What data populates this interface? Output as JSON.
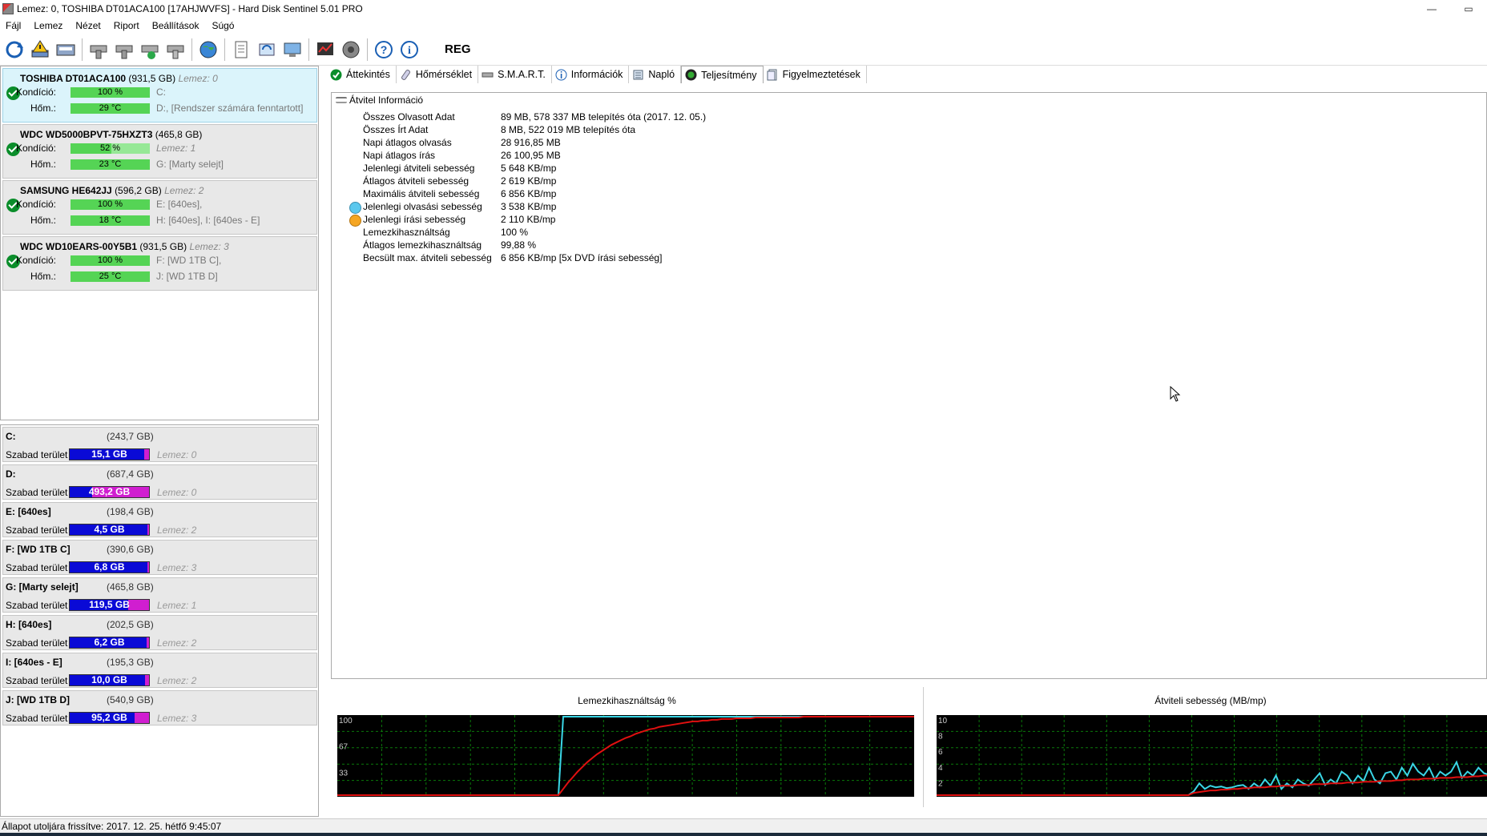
{
  "window": {
    "title": "Lemez: 0, TOSHIBA DT01ACA100 [17AHJWVFS]  -  Hard Disk Sentinel 5.01 PRO",
    "minimize": "—",
    "restore": "▭"
  },
  "menu": [
    "Fájl",
    "Lemez",
    "Nézet",
    "Riport",
    "Beállítások",
    "Súgó"
  ],
  "toolbar": {
    "icons": [
      "refresh-icon",
      "warning-disk-icon",
      "disk-icon",
      "tool-1-icon",
      "tool-2-icon",
      "tool-3-icon",
      "tool-4-icon",
      "globe-icon",
      "document-icon",
      "sync-icon",
      "network-icon",
      "report-icon",
      "speaker-icon",
      "help-icon",
      "info-icon"
    ],
    "reg_label": "REG"
  },
  "disks": [
    {
      "name": "TOSHIBA DT01ACA100",
      "size": "(931,5 GB)",
      "lemez": "Lemez: 0",
      "kondicio_label": "Kondíció:",
      "kondicio": "100 %",
      "kondicio_pct": 100,
      "hom_label": "Hőm.:",
      "hom": "29 °C",
      "drive1": "C:",
      "drive2": "D:, [Rendszer számára fenntartott]",
      "drive1_italic": false,
      "selected": true
    },
    {
      "name": "WDC WD5000BPVT-75HXZT3",
      "size": "(465,8 GB)",
      "lemez": "",
      "kondicio_label": "Kondíció:",
      "kondicio": "52 %",
      "kondicio_pct": 52,
      "hom_label": "Hőm.:",
      "hom": "23 °C",
      "drive1": "Lemez: 1",
      "drive2": "G: [Marty selejt]",
      "drive1_italic": true,
      "selected": false
    },
    {
      "name": "SAMSUNG HE642JJ",
      "size": "(596,2 GB)",
      "lemez": "Lemez: 2",
      "kondicio_label": "Kondíció:",
      "kondicio": "100 %",
      "kondicio_pct": 100,
      "hom_label": "Hőm.:",
      "hom": "18 °C",
      "drive1": "E: [640es],",
      "drive2": "H: [640es], I: [640es - E]",
      "drive1_italic": false,
      "selected": false
    },
    {
      "name": "WDC WD10EARS-00Y5B1",
      "size": "(931,5 GB)",
      "lemez": "Lemez: 3",
      "kondicio_label": "Kondíció:",
      "kondicio": "100 %",
      "kondicio_pct": 100,
      "hom_label": "Hőm.:",
      "hom": "25 °C",
      "drive1": "F: [WD 1TB C],",
      "drive2": "J: [WD 1TB D]",
      "drive1_italic": false,
      "selected": false
    }
  ],
  "partitions": [
    {
      "name": "C:",
      "size": "(243,7 GB)",
      "label": "Szabad terület",
      "free": "15,1 GB",
      "used_pct": 94,
      "lemez": "Lemez: 0"
    },
    {
      "name": "D:",
      "size": "(687,4 GB)",
      "label": "Szabad terület",
      "free": "493,2 GB",
      "used_pct": 28,
      "lemez": "Lemez: 0"
    },
    {
      "name": "E: [640es]",
      "size": "(198,4 GB)",
      "label": "Szabad terület",
      "free": "4,5 GB",
      "used_pct": 98,
      "lemez": "Lemez: 2"
    },
    {
      "name": "F: [WD 1TB C]",
      "size": "(390,6 GB)",
      "label": "Szabad terület",
      "free": "6,8 GB",
      "used_pct": 98,
      "lemez": "Lemez: 3"
    },
    {
      "name": "G: [Marty selejt]",
      "size": "(465,8 GB)",
      "label": "Szabad terület",
      "free": "119,5 GB",
      "used_pct": 74,
      "lemez": "Lemez: 1"
    },
    {
      "name": "H: [640es]",
      "size": "(202,5 GB)",
      "label": "Szabad terület",
      "free": "6,2 GB",
      "used_pct": 97,
      "lemez": "Lemez: 2"
    },
    {
      "name": "I: [640es - E]",
      "size": "(195,3 GB)",
      "label": "Szabad terület",
      "free": "10,0 GB",
      "used_pct": 95,
      "lemez": "Lemez: 2"
    },
    {
      "name": "J: [WD 1TB D]",
      "size": "(540,9 GB)",
      "label": "Szabad terület",
      "free": "95,2 GB",
      "used_pct": 82,
      "lemez": "Lemez: 3"
    }
  ],
  "tabs": [
    "Áttekintés",
    "Hőmérséklet",
    "S.M.A.R.T.",
    "Információk",
    "Napló",
    "Teljesítmény",
    "Figyelmeztetések"
  ],
  "active_tab": "Teljesítmény",
  "section": {
    "title": "Átvitel Információ"
  },
  "info": [
    {
      "key": "Összes Olvasott Adat",
      "value": "89 MB,  578 337 MB telepítés óta  (2017. 12. 05.)"
    },
    {
      "key": "Összes Írt Adat",
      "value": "8 MB,  522 019 MB telepítés óta"
    },
    {
      "key": "Napi átlagos olvasás",
      "value": "28 916,85 MB"
    },
    {
      "key": "Napi átlagos írás",
      "value": "26 100,95 MB"
    },
    {
      "key": "Jelenlegi átviteli sebesség",
      "value": "5 648 KB/mp"
    },
    {
      "key": "Átlagos átviteli sebesség",
      "value": "2 619 KB/mp"
    },
    {
      "key": "Maximális átviteli sebesség",
      "value": "6 856 KB/mp"
    },
    {
      "key": "Jelenlegi olvasási sebesség",
      "value": "3 538 KB/mp"
    },
    {
      "key": "Jelenlegi írási sebesség",
      "value": "2 110 KB/mp"
    },
    {
      "key": "Lemezkihasználtság",
      "value": "100 %"
    },
    {
      "key": "Átlagos lemezkihasználtság",
      "value": "99,88 %"
    },
    {
      "key": "Becsült max. átviteli sebesség",
      "value": "6 856 KB/mp [5x DVD írási sebesség]"
    }
  ],
  "colors": {
    "read": "#5bc8ee",
    "write": "#f5a623",
    "ok": "#0a8d2a",
    "free_bar": "#0a0ad6",
    "used_bar": "#d01ed0"
  },
  "chart_data": [
    {
      "type": "line",
      "title": "Lemezkihasználtság %",
      "ylim": [
        0,
        100
      ],
      "yticks": [
        "100",
        "67",
        "33"
      ],
      "series": [
        {
          "values": [
            0,
            0,
            0,
            0,
            0,
            0,
            0,
            0,
            0,
            0,
            0,
            0,
            0,
            0,
            0,
            0,
            0,
            0,
            0,
            0,
            0,
            0,
            0,
            0,
            0,
            0,
            0,
            0,
            0,
            0,
            0,
            0,
            0,
            0,
            0,
            0,
            0,
            0,
            0,
            0,
            0,
            0,
            0,
            0,
            0,
            0,
            0,
            100,
            100,
            100,
            100,
            100,
            100,
            100,
            100,
            100,
            100,
            100,
            100,
            100,
            100,
            100,
            100,
            100,
            100,
            100,
            100,
            100,
            100,
            100,
            100,
            100,
            100,
            100,
            100,
            100,
            100,
            100,
            100,
            100,
            100,
            100,
            100,
            100,
            100,
            100,
            100,
            100,
            100,
            100,
            100,
            100,
            100,
            100,
            100,
            100,
            100,
            100,
            100,
            100,
            100,
            100,
            100,
            100,
            100,
            100,
            100,
            100,
            100,
            100,
            100,
            100,
            100,
            100,
            100,
            100,
            100,
            100,
            100,
            100,
            100
          ]
        },
        {
          "values": [
            0,
            0,
            0,
            0,
            0,
            0,
            0,
            0,
            0,
            0,
            0,
            0,
            0,
            0,
            0,
            0,
            0,
            0,
            0,
            0,
            0,
            0,
            0,
            0,
            0,
            0,
            0,
            0,
            0,
            0,
            0,
            0,
            0,
            0,
            0,
            0,
            0,
            0,
            0,
            0,
            0,
            0,
            0,
            0,
            0,
            0,
            0,
            8,
            16,
            23,
            30,
            36,
            42,
            47,
            52,
            56,
            60,
            64,
            67,
            70,
            73,
            75,
            78,
            80,
            82,
            84,
            85,
            87,
            88,
            89,
            90,
            91,
            92,
            93,
            94,
            94,
            95,
            95,
            96,
            96,
            97,
            97,
            97,
            98,
            98,
            98,
            98,
            99,
            99,
            99,
            99,
            99,
            99,
            99,
            99,
            99,
            99,
            100,
            100,
            100,
            100,
            100,
            100,
            100,
            100,
            100,
            100,
            100,
            100,
            100,
            100,
            100,
            100,
            100,
            100,
            100,
            100,
            100,
            100,
            100,
            100
          ]
        }
      ]
    },
    {
      "type": "line",
      "title": "Átviteli sebesség (MB/mp)",
      "ylim": [
        0,
        10
      ],
      "yticks": [
        "10",
        "8",
        "6",
        "4",
        "2"
      ],
      "series": [
        {
          "values": [
            0,
            0,
            0,
            0,
            0,
            0,
            0,
            0,
            0,
            0,
            0,
            0,
            0,
            0,
            0,
            0,
            0,
            0,
            0,
            0,
            0,
            0,
            0,
            0,
            0,
            0,
            0,
            0,
            0,
            0,
            0,
            0,
            0,
            0,
            0,
            0,
            0,
            0,
            0,
            0,
            0,
            0,
            0,
            0,
            0,
            0,
            0,
            0.5,
            1.5,
            0.8,
            1.2,
            1.0,
            1.1,
            0.9,
            1.0,
            1.2,
            1.3,
            0.8,
            1.5,
            1.0,
            2.0,
            1.2,
            2.5,
            0.8,
            1.5,
            1.0,
            2.0,
            1.5,
            1.2,
            2.0,
            2.8,
            1.3,
            2.0,
            1.5,
            3.0,
            2.5,
            1.5,
            2.5,
            1.8,
            3.5,
            2.0,
            1.5,
            2.8,
            3.0,
            2.0,
            3.5,
            2.5,
            4.0,
            3.0,
            2.5,
            3.5,
            2.0,
            3.0,
            2.5,
            3.0,
            4.2,
            2.2,
            3.0,
            2.5,
            3.5,
            2.8,
            2.6
          ]
        },
        {
          "values": [
            0,
            0,
            0,
            0,
            0,
            0,
            0,
            0,
            0,
            0,
            0,
            0,
            0,
            0,
            0,
            0,
            0,
            0,
            0,
            0,
            0,
            0,
            0,
            0,
            0,
            0,
            0,
            0,
            0,
            0,
            0,
            0,
            0,
            0,
            0,
            0,
            0,
            0,
            0,
            0,
            0,
            0,
            0,
            0,
            0,
            0,
            0,
            0.3,
            0.4,
            0.5,
            0.6,
            0.6,
            0.7,
            0.7,
            0.8,
            0.8,
            0.9,
            0.9,
            1.0,
            1.0,
            1.0,
            1.1,
            1.1,
            1.2,
            1.2,
            1.2,
            1.3,
            1.3,
            1.3,
            1.4,
            1.4,
            1.4,
            1.5,
            1.5,
            1.5,
            1.6,
            1.6,
            1.6,
            1.7,
            1.7,
            1.7,
            1.8,
            1.8,
            1.8,
            1.9,
            1.9,
            2.0,
            2.0,
            2.0,
            2.1,
            2.1,
            2.1,
            2.2,
            2.2,
            2.2,
            2.3,
            2.3,
            2.3,
            2.4,
            2.4,
            2.5,
            2.5
          ]
        }
      ]
    }
  ],
  "status": {
    "text": "Állapot utoljára frissítve: 2017. 12. 25. hétfő 9:45:07"
  }
}
